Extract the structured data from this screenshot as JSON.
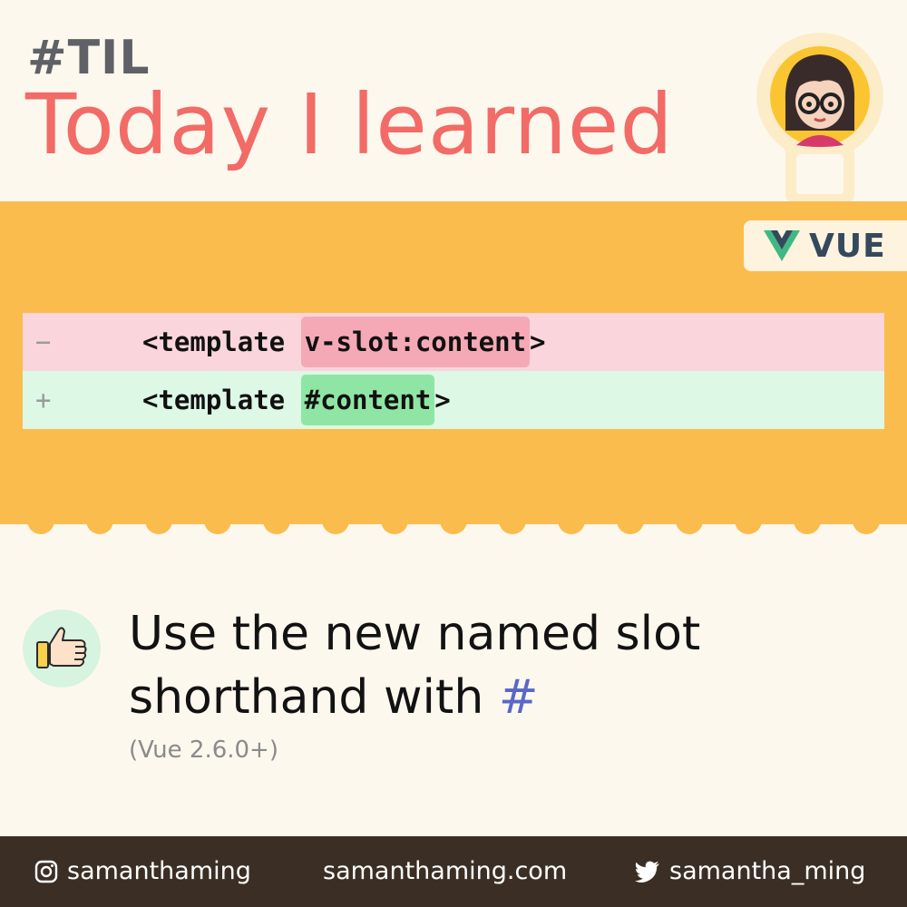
{
  "header": {
    "tag": "#TIL",
    "title": "Today I learned"
  },
  "badge": {
    "label": "VUE",
    "icon": "vue-logo-icon",
    "colors": {
      "green": "#41b883",
      "dark": "#35495e"
    }
  },
  "diff": {
    "removed": {
      "sign": "−",
      "prefix": "<template ",
      "highlight": "v-slot:content",
      "suffix": ">"
    },
    "added": {
      "sign": "+",
      "prefix": "<template ",
      "highlight": "#content",
      "suffix": ">"
    }
  },
  "tip": {
    "icon": "thumbs-up-icon",
    "text": "Use the new named slot shorthand with ",
    "highlight": "#",
    "version": "(Vue 2.6.0+)"
  },
  "footer": {
    "instagram": "samanthaming",
    "website": "samanthaming.com",
    "twitter": "samantha_ming"
  },
  "colors": {
    "title": "#f26b66",
    "band": "#fbbc4e",
    "background": "#fdf8ee",
    "footer": "#3b2f25",
    "hash": "#5867c9"
  }
}
